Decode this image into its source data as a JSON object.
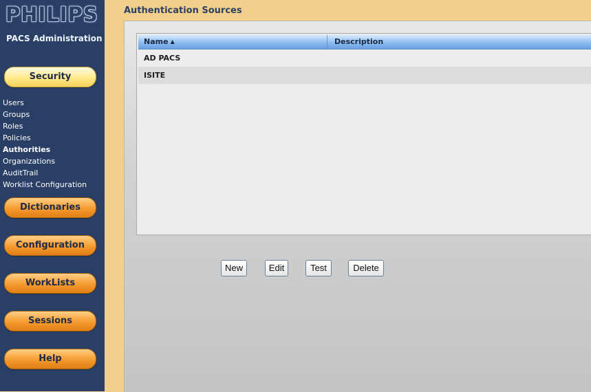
{
  "sidebar": {
    "logo": "PHILIPS",
    "app_title": "PACS Administration",
    "security_label": "Security",
    "sub_items": [
      "Users",
      "Groups",
      "Roles",
      "Policies",
      "Authorities",
      "Organizations",
      "AuditTrail",
      "Worklist Configuration"
    ],
    "active_sub_item": "Authorities",
    "buttons": [
      "Dictionaries",
      "Configuration",
      "WorkLists",
      "Sessions",
      "Help"
    ]
  },
  "main": {
    "heading": "Authentication Sources",
    "table": {
      "columns": [
        "Name",
        "Description"
      ],
      "sort_column": "Name",
      "sort_direction": "ascending",
      "rows": [
        {
          "name": "AD PACS",
          "description": ""
        },
        {
          "name": "ISITE",
          "description": ""
        }
      ]
    },
    "actions": [
      "New",
      "Edit",
      "Test",
      "Delete"
    ]
  },
  "colors": {
    "sidebar": "#2a3f66",
    "accent": "#f59a2e",
    "active_nav": "#ffe98a",
    "grid_header": "#8cbcf0"
  }
}
